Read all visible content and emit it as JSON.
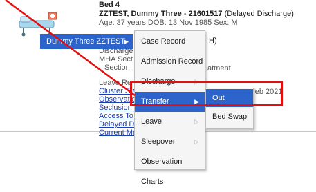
{
  "patient": {
    "bed": "Bed 4",
    "name": "ZZTEST, Dummy Three",
    "id": "21601517",
    "status": "(Delayed Discharge)",
    "demographics": "Age: 37 years DOB: 13 Nov 1985 Sex: M",
    "frag_h": "H)",
    "discharge_label": "Discharge",
    "mha_label": "MHA Sect",
    "section_label": "Section",
    "atment_frag": "atment",
    "leave_label": "Leave Re",
    "feb_frag": "Feb 2021",
    "links": [
      "Cluster Sta",
      "Observatio",
      "Seclusion R",
      "Access To I",
      "Delayed Di",
      "Current Me"
    ]
  },
  "context_menu": {
    "patient_label": "Dummy Three ZZTEST",
    "items": [
      "Case Record",
      "Admission Record",
      "Discharge",
      "Transfer",
      "Leave",
      "Sleepover",
      "Observation Charts"
    ],
    "active_item": "Transfer"
  },
  "submenu": {
    "items": [
      "Out",
      "Bed Swap"
    ],
    "active_item": "Out"
  },
  "colors": {
    "menu_active": "#2c64cc",
    "highlight_box": "#e01010",
    "pointer_line": "#e01010",
    "link": "#1f3fae"
  }
}
